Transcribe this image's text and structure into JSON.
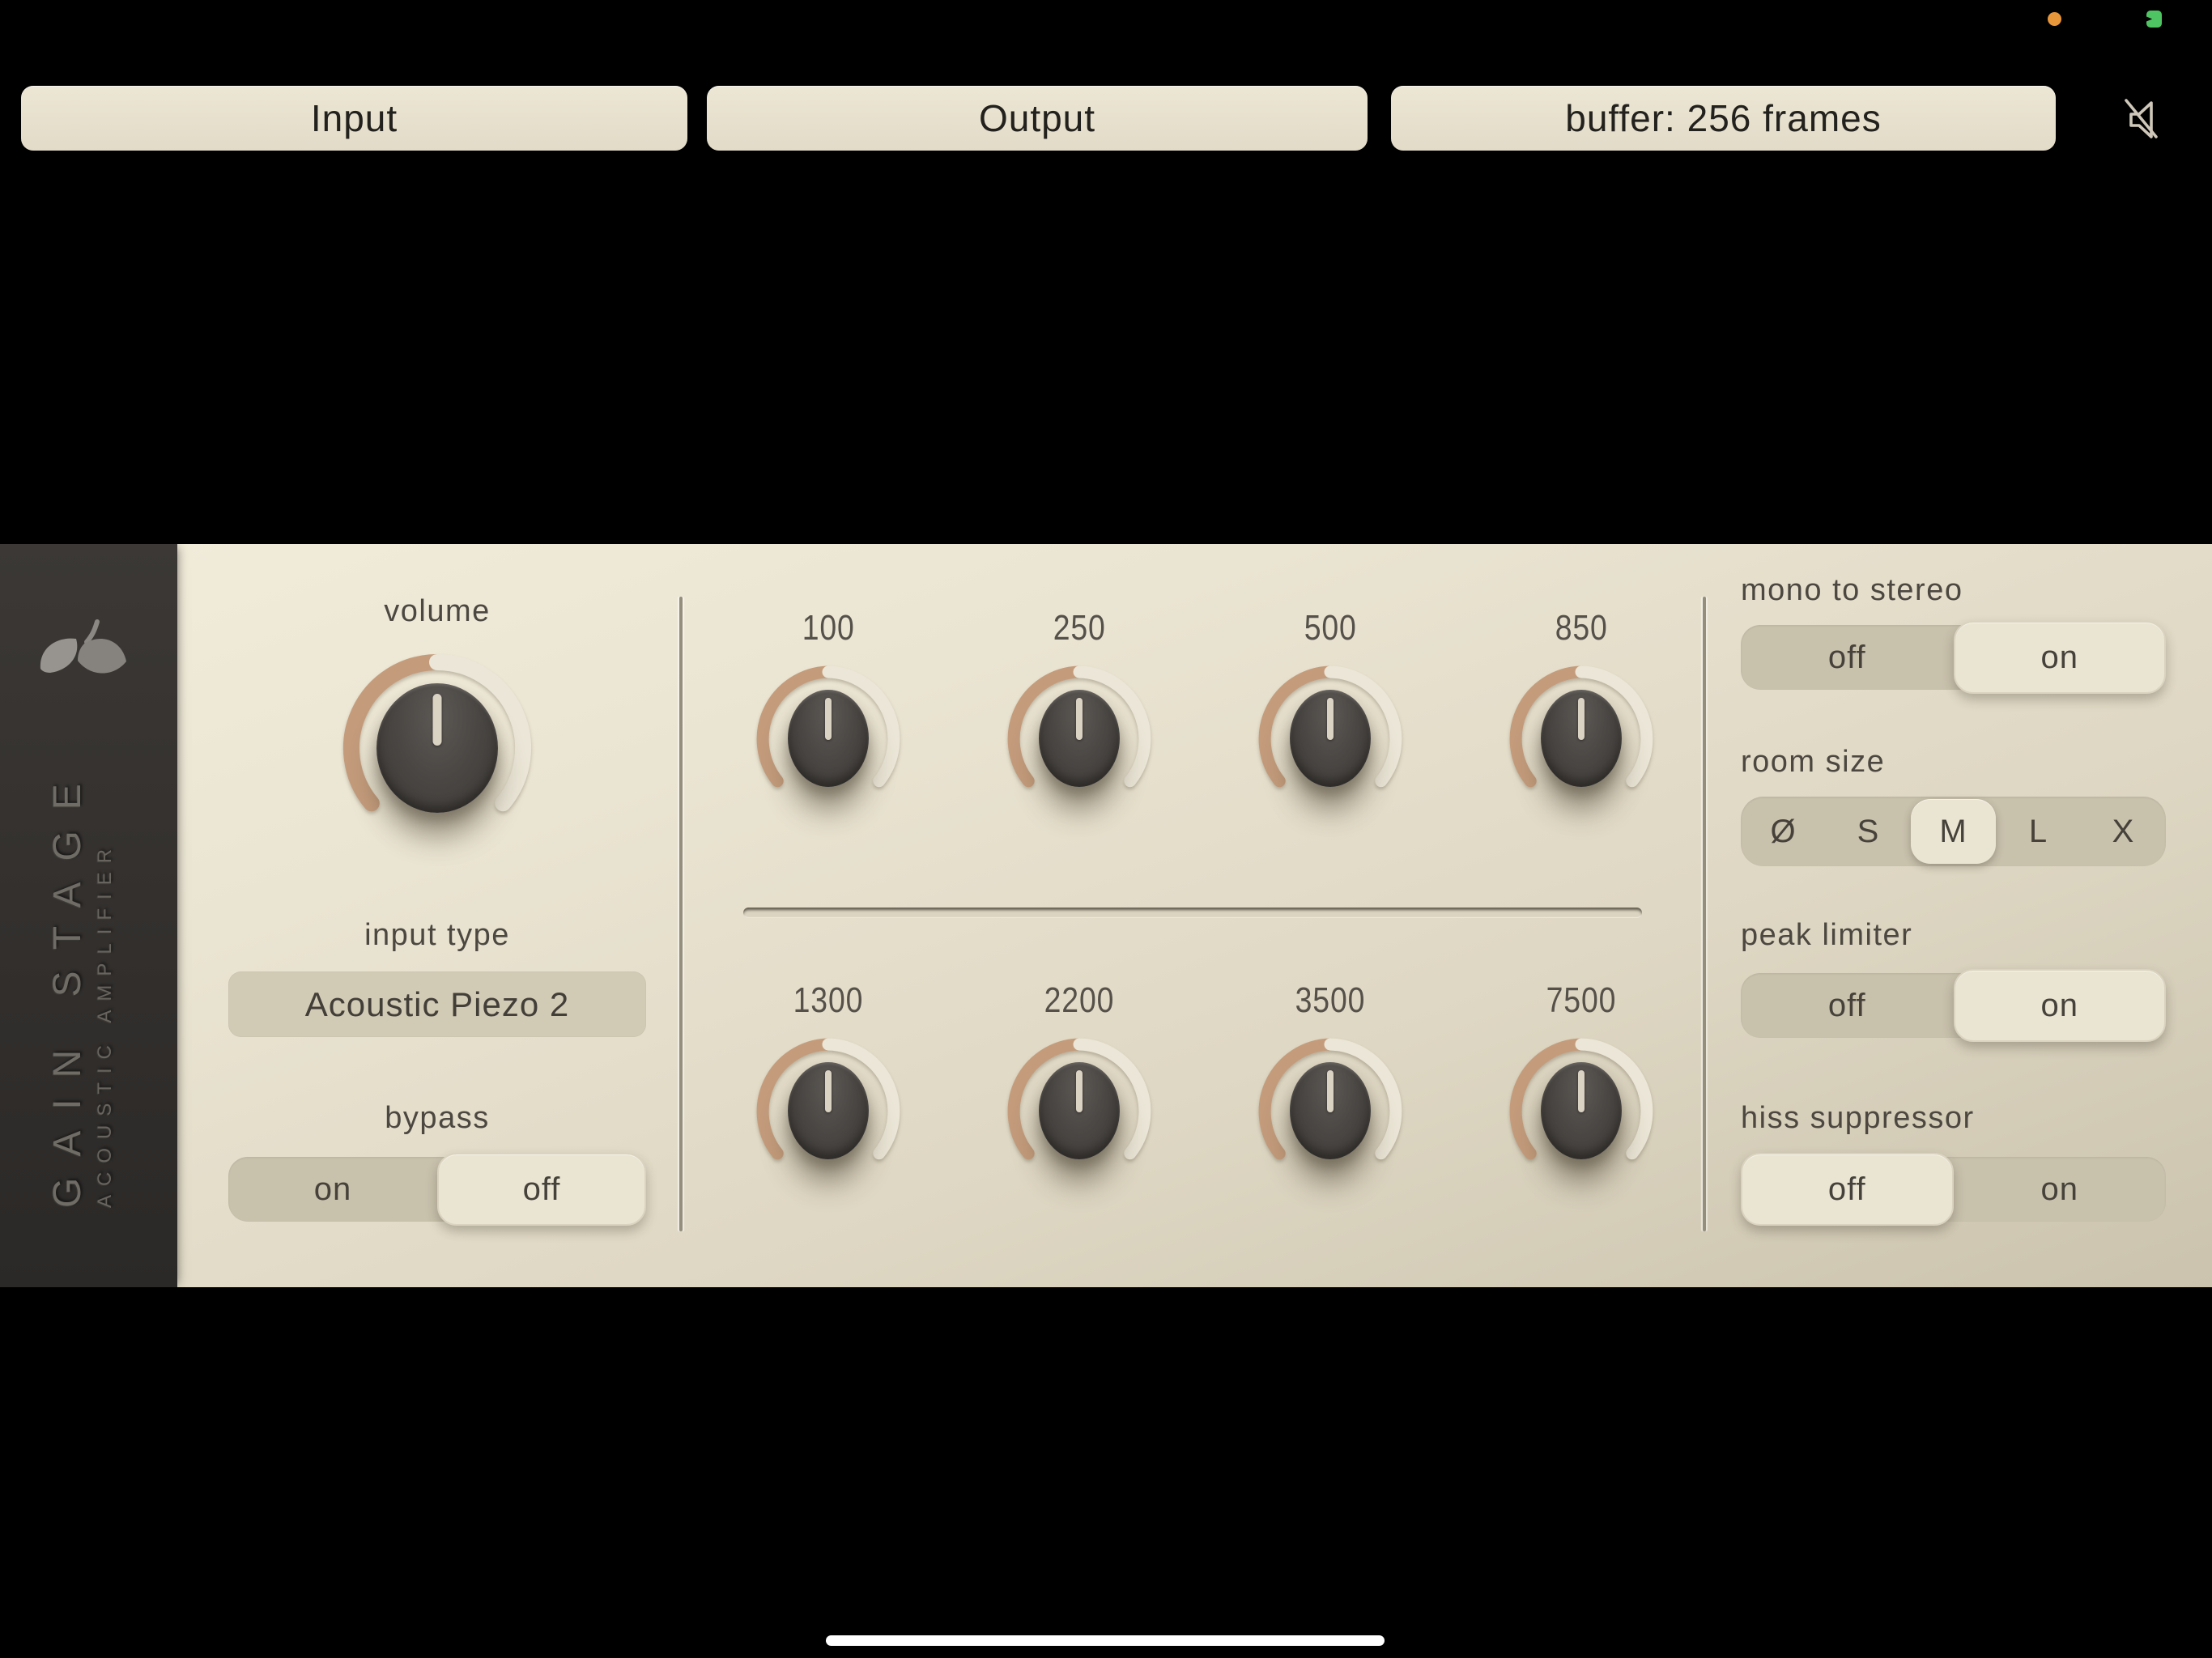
{
  "status_bar": {
    "icons": [
      {
        "name": "mic-active-indicator",
        "color": "#e8963a"
      },
      {
        "name": "battery-charging-icon",
        "color": "#4fc462"
      }
    ]
  },
  "toolbar": {
    "input_label": "Input",
    "output_label": "Output",
    "buffer_label": "buffer: 256 frames",
    "mute_icon": "speaker-slash"
  },
  "branding": {
    "logo_icon": "leaf-logo",
    "title": "GAIN STAGE",
    "subtitle": "ACOUSTIC AMPLIFIER"
  },
  "left_panel": {
    "volume": {
      "label": "volume",
      "value_percent": 50
    },
    "input_type": {
      "label": "input type",
      "value": "Acoustic Piezo 2"
    },
    "bypass": {
      "label": "bypass",
      "options": [
        "on",
        "off"
      ],
      "selected": "off"
    }
  },
  "eq": {
    "top_row": [
      {
        "label": "100",
        "value_percent": 50
      },
      {
        "label": "250",
        "value_percent": 50
      },
      {
        "label": "500",
        "value_percent": 50
      },
      {
        "label": "850",
        "value_percent": 50
      }
    ],
    "bottom_row": [
      {
        "label": "1300",
        "value_percent": 50
      },
      {
        "label": "2200",
        "value_percent": 50
      },
      {
        "label": "3500",
        "value_percent": 50
      },
      {
        "label": "7500",
        "value_percent": 50
      }
    ]
  },
  "right_panel": {
    "mono_to_stereo": {
      "label": "mono to stereo",
      "options": [
        "off",
        "on"
      ],
      "selected": "on"
    },
    "room_size": {
      "label": "room size",
      "options": [
        "Ø",
        "S",
        "M",
        "L",
        "X"
      ],
      "selected": "M"
    },
    "peak_limiter": {
      "label": "peak limiter",
      "options": [
        "off",
        "on"
      ],
      "selected": "on"
    },
    "hiss_suppressor": {
      "label": "hiss suppressor",
      "options": [
        "off",
        "on"
      ],
      "selected": "off"
    }
  },
  "colors": {
    "accent_tan_arc": "#c49c7c",
    "cream_arc": "#ebe6d7",
    "panel_beige": "#e7e1cf",
    "track_beige": "#c8c1ac",
    "chip_beige": "#eae5d3",
    "knob_dark": "#46423f",
    "sidebar_dark": "#343130"
  }
}
